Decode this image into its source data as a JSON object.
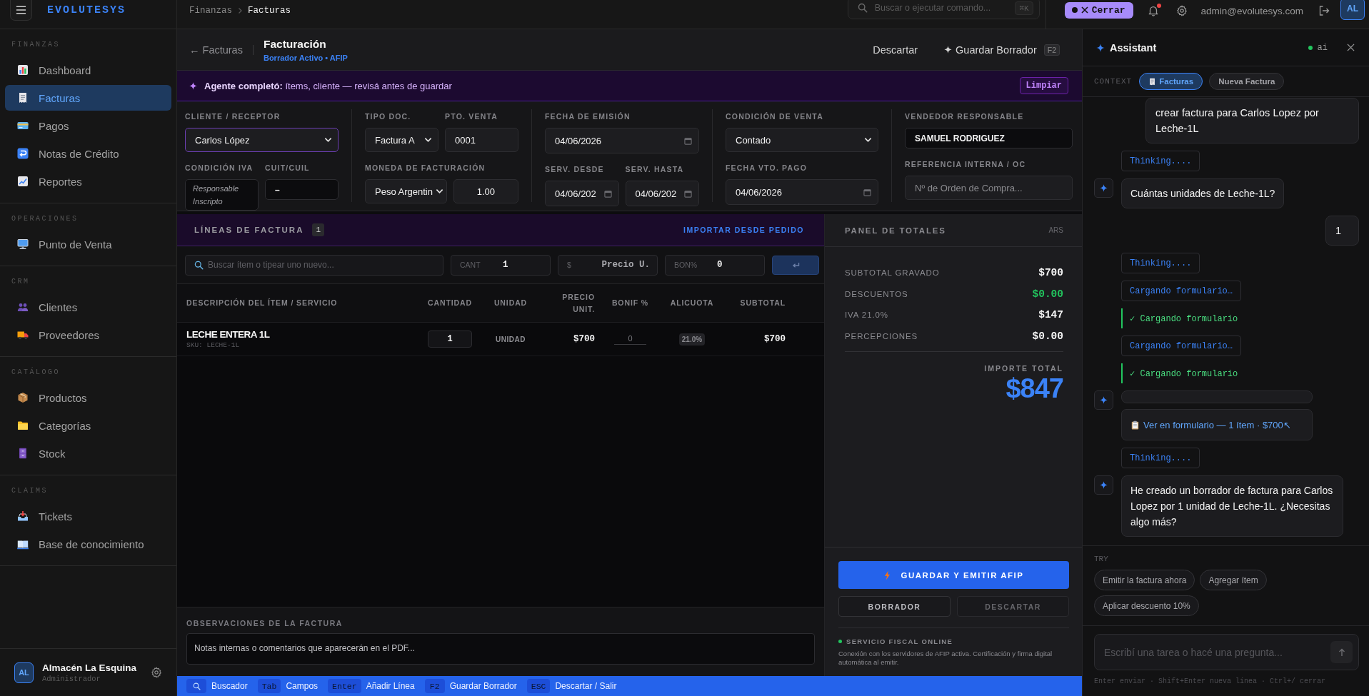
{
  "sidebar": {
    "logo": "EVOLUTESYS",
    "sections": [
      {
        "title": "FINANZAS",
        "items": [
          {
            "label": "Dashboard",
            "selected": false
          },
          {
            "label": "Facturas",
            "selected": true
          },
          {
            "label": "Pagos",
            "selected": false
          },
          {
            "label": "Notas de Crédito",
            "selected": false
          },
          {
            "label": "Reportes",
            "selected": false
          }
        ]
      },
      {
        "title": "OPERACIONES",
        "items": [
          {
            "label": "Punto de Venta",
            "selected": false
          }
        ]
      },
      {
        "title": "CRM",
        "items": [
          {
            "label": "Clientes",
            "selected": false
          },
          {
            "label": "Proveedores",
            "selected": false
          }
        ]
      },
      {
        "title": "CATÁLOGO",
        "items": [
          {
            "label": "Productos",
            "selected": false
          },
          {
            "label": "Categorías",
            "selected": false
          },
          {
            "label": "Stock",
            "selected": false
          }
        ]
      },
      {
        "title": "CLAIMS",
        "items": [
          {
            "label": "Tickets",
            "selected": false
          },
          {
            "label": "Base de conocimiento",
            "selected": false
          }
        ]
      }
    ],
    "user": {
      "initials": "AL",
      "name": "Almacén La Esquina",
      "role": "Administrador"
    }
  },
  "topbar": {
    "breadcrumb": [
      {
        "label": "Finanzas",
        "current": false
      },
      {
        "label": "Facturas",
        "current": true
      }
    ],
    "search": {
      "placeholder": "Buscar o ejecutar comando...",
      "shortcut": "⌘K"
    },
    "close_button": "Cerrar",
    "notifications": true,
    "email": "admin@evolutesys.com",
    "avatar": "AL"
  },
  "header": {
    "back_link": "← Facturas",
    "title": "Facturación",
    "subtitle": "Borrador Activo • AFIP",
    "discard_button": "Descartar",
    "save_button": "Guardar Borrador",
    "save_shortcut": "F2"
  },
  "agent_banner": {
    "message": "**Agente completó:** ítems, cliente — revisá antes de guardar",
    "clear_button": "Limpiar"
  },
  "form": {
    "columns": [
      {
        "rows": [
          {
            "groups": [
              {
                "label": "CLIENTE / RECEPTOR",
                "controls": [
                  {
                    "kind": "select",
                    "value": "Carlos López",
                    "highlighted": true
                  }
                ]
              }
            ]
          },
          {
            "groups": [
              {
                "label": "CONDICIÓN IVA",
                "controls": [
                  {
                    "kind": "note",
                    "value": "Responsable Inscripto",
                    "highlighted": false
                  }
                ]
              },
              {
                "label": "CUIT/CUIL",
                "controls": [
                  {
                    "kind": "readonly",
                    "value": "–",
                    "highlighted": false
                  }
                ]
              }
            ]
          }
        ]
      },
      {
        "rows": [
          {
            "groups": [
              {
                "label": "TIPO DOC.",
                "controls": [
                  {
                    "kind": "select",
                    "value": "Factura A",
                    "highlighted": false
                  }
                ]
              },
              {
                "label": "PTO. VENTA",
                "controls": [
                  {
                    "kind": "text",
                    "value": "0001",
                    "highlighted": false
                  }
                ]
              }
            ]
          },
          {
            "groups": [
              {
                "label": "MONEDA DE FACTURACIÓN",
                "controls": [
                  {
                    "kind": "select",
                    "value": "Peso Argentin",
                    "highlighted": false
                  },
                  {
                    "kind": "number",
                    "value": "1.00",
                    "highlighted": false
                  }
                ]
              }
            ]
          }
        ]
      },
      {
        "rows": [
          {
            "groups": [
              {
                "label": "FECHA DE EMISIÓN",
                "controls": [
                  {
                    "kind": "date",
                    "value": "04/06/2026",
                    "highlighted": false
                  }
                ]
              }
            ]
          },
          {
            "groups": [
              {
                "label": "SERV. DESDE",
                "controls": [
                  {
                    "kind": "date",
                    "value": "04/06/202",
                    "highlighted": false
                  }
                ]
              },
              {
                "label": "SERV. HASTA",
                "controls": [
                  {
                    "kind": "date",
                    "value": "04/06/202",
                    "highlighted": false
                  }
                ]
              }
            ]
          }
        ]
      },
      {
        "rows": [
          {
            "groups": [
              {
                "label": "CONDICIÓN DE VENTA",
                "controls": [
                  {
                    "kind": "select",
                    "value": "Contado",
                    "highlighted": false
                  }
                ]
              }
            ]
          },
          {
            "groups": [
              {
                "label": "FECHA VTO. PAGO",
                "controls": [
                  {
                    "kind": "date",
                    "value": "04/06/2026",
                    "highlighted": false
                  }
                ]
              }
            ]
          }
        ]
      },
      {
        "rows": [
          {
            "groups": [
              {
                "label": "VENDEDOR RESPONSABLE",
                "controls": [
                  {
                    "kind": "readonly",
                    "value": "SAMUEL RODRIGUEZ",
                    "highlighted": false
                  }
                ]
              }
            ]
          },
          {
            "groups": [
              {
                "label": "REFERENCIA INTERNA / OC",
                "controls": [
                  {
                    "kind": "text",
                    "placeholder": "Nº de Orden de Compra...",
                    "highlighted": false
                  }
                ]
              }
            ]
          }
        ]
      }
    ]
  },
  "lines": {
    "title": "LÍNEAS DE FACTURA",
    "count": "1",
    "import_link": "IMPORTAR DESDE PEDIDO",
    "entry": {
      "search_placeholder": "Buscar ítem o tipear uno nuevo...",
      "quantity_label": "CANT",
      "quantity": "1",
      "price_label": "$",
      "price_placeholder": "Precio U.",
      "discount_label": "BON%",
      "discount": "0"
    },
    "table": {
      "columns": [
        "DESCRIPCIÓN DEL ÍTEM / SERVICIO",
        "CANTIDAD",
        "UNIDAD",
        "PRECIO UNIT.",
        "BONIF %",
        "ALICUOTA",
        "SUBTOTAL"
      ],
      "rows": [
        {
          "description": "LECHE ENTERA 1L",
          "sku": "SKU: LECHE-1L",
          "quantity": "1",
          "unit": "UNIDAD",
          "unit_price": "$700",
          "discount": "0",
          "tax_rate": "21.0%",
          "subtotal": "$700"
        }
      ]
    },
    "notes": {
      "label": "OBSERVACIONES DE LA FACTURA",
      "placeholder": "Notas internas o comentarios que aparecerán en el PDF..."
    }
  },
  "totals": {
    "title": "PANEL DE TOTALES",
    "currency": "ARS",
    "rows": [
      {
        "label": "SUBTOTAL GRAVADO",
        "value": "$700",
        "kind": "charge"
      },
      {
        "label": "DESCUENTOS",
        "value": "$0.00",
        "kind": "discount"
      },
      {
        "label": "IVA 21.0%",
        "value": "$147",
        "kind": "charge"
      },
      {
        "label": "PERCEPCIONES",
        "value": "$0.00",
        "kind": "charge"
      }
    ],
    "total_label": "IMPORTE TOTAL",
    "total": "$847",
    "actions": [
      {
        "label": "GUARDAR Y EMITIR AFIP",
        "kind": "primary",
        "disabled": false
      },
      {
        "label": "BORRADOR",
        "kind": "secondary",
        "disabled": false
      },
      {
        "label": "DESCARTAR",
        "kind": "secondary",
        "disabled": true
      }
    ],
    "service": {
      "label": "SERVICIO FISCAL ONLINE",
      "online": true,
      "description": "Conexión con los servidores de AFIP activa. Certificación y firma digital automática al emitir."
    }
  },
  "shortcuts": [
    {
      "kind": "icon",
      "label": "Buscador"
    },
    {
      "kind": "key",
      "key": "Tab",
      "label": "Campos"
    },
    {
      "kind": "key",
      "key": "Enter",
      "label": "Añadir Línea"
    },
    {
      "kind": "key",
      "key": "F2",
      "label": "Guardar Borrador"
    },
    {
      "kind": "key",
      "key": "ESC",
      "label": "Descartar / Salir"
    }
  ],
  "assistant": {
    "title": "Assistant",
    "status": {
      "label": "ai",
      "online": true
    },
    "context_label": "CONTEXT",
    "context": [
      {
        "label": "Facturas",
        "kind": "module",
        "selected": true
      },
      {
        "label": "Nueva Factura",
        "kind": "record",
        "selected": false
      }
    ],
    "messages": [
      {
        "kind": "user",
        "text": "crear factura para Carlos Lopez por Leche-1L"
      },
      {
        "kind": "thinking",
        "text": "Thinking...."
      },
      {
        "kind": "assistant",
        "text": "Cuántas unidades de Leche-1L?"
      },
      {
        "kind": "user",
        "text": "1"
      },
      {
        "kind": "thinking",
        "text": "Thinking...."
      },
      {
        "kind": "tool",
        "text": "Cargando formulario…"
      },
      {
        "kind": "done",
        "text": "✓ Cargando formulario"
      },
      {
        "kind": "tool",
        "text": "Cargando formulario…"
      },
      {
        "kind": "done",
        "text": "✓ Cargando formulario"
      },
      {
        "kind": "card",
        "text": "Ver en formulario — 1 ítem · $700↖"
      },
      {
        "kind": "thinking",
        "text": "Thinking...."
      },
      {
        "kind": "assistant",
        "text": "He creado un borrador de factura para Carlos Lopez por 1 unidad de Leche-1L. ¿Necesitas algo más?"
      }
    ],
    "suggestions_label": "TRY",
    "suggestions": [
      "Emitir la factura ahora",
      "Agregar ítem",
      "Aplicar descuento 10%"
    ],
    "input": {
      "placeholder": "Escribí una tarea o hacé una pregunta..."
    },
    "hint": "Enter enviar · Shift+Enter nueva línea · Ctrl+/ cerrar"
  }
}
